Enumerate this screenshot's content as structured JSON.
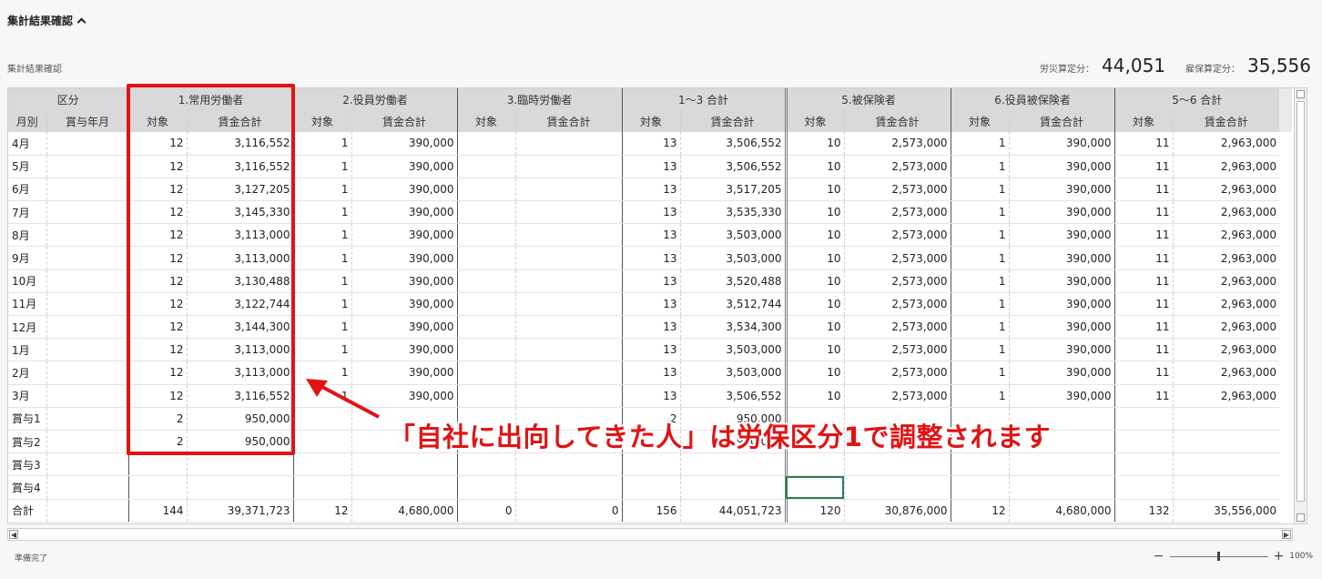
{
  "header": {
    "title": "集計結果確認"
  },
  "subtitle": "集計結果確認",
  "summary": {
    "rosai_label": "労災算定分：",
    "rosai_value": "44,051",
    "koyo_label": "雇保算定分：",
    "koyo_value": "35,556"
  },
  "groups": [
    "区分",
    "1.常用労働者",
    "2.役員労働者",
    "3.臨時労働者",
    "1〜3 合計",
    "5.被保険者",
    "6.役員被保険者",
    "5〜6 合計"
  ],
  "subheaders": {
    "month": "月別",
    "bonus_month": "賞与年月",
    "count": "対象",
    "wage": "賃金合計"
  },
  "rows": [
    {
      "label": "4月",
      "c1": "12",
      "w1": "3,116,552",
      "c2": "1",
      "w2": "390,000",
      "c3": "",
      "w3": "",
      "c4": "13",
      "w4": "3,506,552",
      "c5": "10",
      "w5": "2,573,000",
      "c6": "1",
      "w6": "390,000",
      "c7": "11",
      "w7": "2,963,000"
    },
    {
      "label": "5月",
      "c1": "12",
      "w1": "3,116,552",
      "c2": "1",
      "w2": "390,000",
      "c3": "",
      "w3": "",
      "c4": "13",
      "w4": "3,506,552",
      "c5": "10",
      "w5": "2,573,000",
      "c6": "1",
      "w6": "390,000",
      "c7": "11",
      "w7": "2,963,000"
    },
    {
      "label": "6月",
      "c1": "12",
      "w1": "3,127,205",
      "c2": "1",
      "w2": "390,000",
      "c3": "",
      "w3": "",
      "c4": "13",
      "w4": "3,517,205",
      "c5": "10",
      "w5": "2,573,000",
      "c6": "1",
      "w6": "390,000",
      "c7": "11",
      "w7": "2,963,000"
    },
    {
      "label": "7月",
      "c1": "12",
      "w1": "3,145,330",
      "c2": "1",
      "w2": "390,000",
      "c3": "",
      "w3": "",
      "c4": "13",
      "w4": "3,535,330",
      "c5": "10",
      "w5": "2,573,000",
      "c6": "1",
      "w6": "390,000",
      "c7": "11",
      "w7": "2,963,000"
    },
    {
      "label": "8月",
      "c1": "12",
      "w1": "3,113,000",
      "c2": "1",
      "w2": "390,000",
      "c3": "",
      "w3": "",
      "c4": "13",
      "w4": "3,503,000",
      "c5": "10",
      "w5": "2,573,000",
      "c6": "1",
      "w6": "390,000",
      "c7": "11",
      "w7": "2,963,000"
    },
    {
      "label": "9月",
      "c1": "12",
      "w1": "3,113,000",
      "c2": "1",
      "w2": "390,000",
      "c3": "",
      "w3": "",
      "c4": "13",
      "w4": "3,503,000",
      "c5": "10",
      "w5": "2,573,000",
      "c6": "1",
      "w6": "390,000",
      "c7": "11",
      "w7": "2,963,000"
    },
    {
      "label": "10月",
      "c1": "12",
      "w1": "3,130,488",
      "c2": "1",
      "w2": "390,000",
      "c3": "",
      "w3": "",
      "c4": "13",
      "w4": "3,520,488",
      "c5": "10",
      "w5": "2,573,000",
      "c6": "1",
      "w6": "390,000",
      "c7": "11",
      "w7": "2,963,000"
    },
    {
      "label": "11月",
      "c1": "12",
      "w1": "3,122,744",
      "c2": "1",
      "w2": "390,000",
      "c3": "",
      "w3": "",
      "c4": "13",
      "w4": "3,512,744",
      "c5": "10",
      "w5": "2,573,000",
      "c6": "1",
      "w6": "390,000",
      "c7": "11",
      "w7": "2,963,000"
    },
    {
      "label": "12月",
      "c1": "12",
      "w1": "3,144,300",
      "c2": "1",
      "w2": "390,000",
      "c3": "",
      "w3": "",
      "c4": "13",
      "w4": "3,534,300",
      "c5": "10",
      "w5": "2,573,000",
      "c6": "1",
      "w6": "390,000",
      "c7": "11",
      "w7": "2,963,000"
    },
    {
      "label": "1月",
      "c1": "12",
      "w1": "3,113,000",
      "c2": "1",
      "w2": "390,000",
      "c3": "",
      "w3": "",
      "c4": "13",
      "w4": "3,503,000",
      "c5": "10",
      "w5": "2,573,000",
      "c6": "1",
      "w6": "390,000",
      "c7": "11",
      "w7": "2,963,000"
    },
    {
      "label": "2月",
      "c1": "12",
      "w1": "3,113,000",
      "c2": "1",
      "w2": "390,000",
      "c3": "",
      "w3": "",
      "c4": "13",
      "w4": "3,503,000",
      "c5": "10",
      "w5": "2,573,000",
      "c6": "1",
      "w6": "390,000",
      "c7": "11",
      "w7": "2,963,000"
    },
    {
      "label": "3月",
      "c1": "12",
      "w1": "3,116,552",
      "c2": "1",
      "w2": "390,000",
      "c3": "",
      "w3": "",
      "c4": "13",
      "w4": "3,506,552",
      "c5": "10",
      "w5": "2,573,000",
      "c6": "1",
      "w6": "390,000",
      "c7": "11",
      "w7": "2,963,000"
    },
    {
      "label": "賞与1",
      "c1": "2",
      "w1": "950,000",
      "c2": "",
      "w2": "",
      "c3": "",
      "w3": "",
      "c4": "2",
      "w4": "950,000",
      "c5": "",
      "w5": "",
      "c6": "",
      "w6": "",
      "c7": "",
      "w7": ""
    },
    {
      "label": "賞与2",
      "c1": "2",
      "w1": "950,000",
      "c2": "",
      "w2": "",
      "c3": "",
      "w3": "",
      "c4": "2",
      "w4": "950,000",
      "c5": "",
      "w5": "",
      "c6": "",
      "w6": "",
      "c7": "",
      "w7": ""
    },
    {
      "label": "賞与3",
      "c1": "",
      "w1": "",
      "c2": "",
      "w2": "",
      "c3": "",
      "w3": "",
      "c4": "",
      "w4": "",
      "c5": "",
      "w5": "",
      "c6": "",
      "w6": "",
      "c7": "",
      "w7": ""
    },
    {
      "label": "賞与4",
      "c1": "",
      "w1": "",
      "c2": "",
      "w2": "",
      "c3": "",
      "w3": "",
      "c4": "",
      "w4": "",
      "c5": "",
      "w5": "",
      "c6": "",
      "w6": "",
      "c7": "",
      "w7": ""
    }
  ],
  "total": {
    "label": "合計",
    "c1": "144",
    "w1": "39,371,723",
    "c2": "12",
    "w2": "4,680,000",
    "c3": "0",
    "w3": "0",
    "c4": "156",
    "w4": "44,051,723",
    "c5": "120",
    "w5": "30,876,000",
    "c6": "12",
    "w6": "4,680,000",
    "c7": "132",
    "w7": "35,556,000"
  },
  "status": "準備完了",
  "zoom": {
    "minus": "−",
    "plus": "+",
    "level": "100%"
  },
  "annotation": "「自社に出向してきた人」は労保区分1で調整されます",
  "colors": {
    "highlight": "#e01414",
    "selection": "#2e7d4f"
  }
}
